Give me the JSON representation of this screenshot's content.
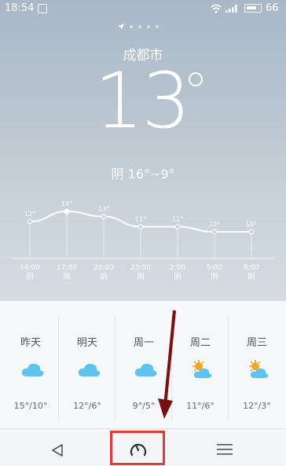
{
  "status": {
    "time": "18:54",
    "battery": "66"
  },
  "page_indicator": {
    "count": 5,
    "active": 0
  },
  "city": "成都市",
  "temperature": "13",
  "condition": "阴 16°~9°",
  "hourly": [
    {
      "time": "14:00",
      "temp": 12,
      "temp_label": "12°",
      "weather": "阴"
    },
    {
      "time": "17:00",
      "temp": 14,
      "temp_label": "14°",
      "weather": "阴"
    },
    {
      "time": "20:00",
      "temp": 13,
      "temp_label": "13°",
      "weather": "阴"
    },
    {
      "time": "23:00",
      "temp": 11,
      "temp_label": "11°",
      "weather": "阴"
    },
    {
      "time": "2:00",
      "temp": 11,
      "temp_label": "11°",
      "weather": "阴"
    },
    {
      "time": "5:00",
      "temp": 10,
      "temp_label": "10°",
      "weather": "阴"
    },
    {
      "time": "8:00",
      "temp": 10,
      "temp_label": "10°",
      "weather": "阴"
    }
  ],
  "daily": [
    {
      "day": "昨天",
      "icon": "cloudy-icon",
      "range": "15°/10°"
    },
    {
      "day": "明天",
      "icon": "cloudy-icon",
      "range": "12°/6°"
    },
    {
      "day": "周一",
      "icon": "cloudy-icon",
      "range": "9°/5°"
    },
    {
      "day": "周二",
      "icon": "partly-sunny-icon",
      "range": "11°/6°"
    },
    {
      "day": "周三",
      "icon": "partly-sunny-icon",
      "range": "12°/3°"
    }
  ],
  "colors": {
    "highlight_box": "#e23a3a",
    "arrow": "#8b1010",
    "cloud": "#5ec4ef",
    "sun": "#f5a623"
  }
}
